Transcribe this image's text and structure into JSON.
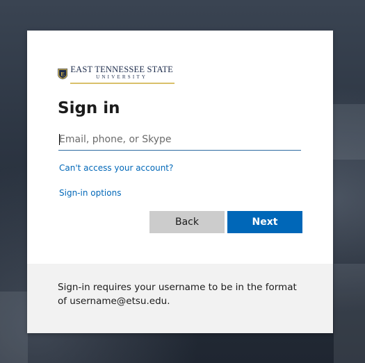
{
  "logo": {
    "shield_letter": "E",
    "line1": "EAST TENNESSEE STATE",
    "line2": "UNIVERSITY",
    "colors": {
      "navy": "#1b2a4a",
      "gold": "#d9c06a"
    }
  },
  "signin": {
    "title": "Sign in",
    "email_placeholder": "Email, phone, or Skype",
    "email_value": ""
  },
  "links": {
    "cant_access": "Can't access your account?",
    "signin_options": "Sign-in options"
  },
  "buttons": {
    "back": "Back",
    "next": "Next"
  },
  "footer": {
    "notice": "Sign-in requires your username to be in the format of username@etsu.edu."
  },
  "colors": {
    "accent": "#0067b8",
    "back_button": "#cccccc",
    "footer_bg": "#f2f2f2"
  }
}
